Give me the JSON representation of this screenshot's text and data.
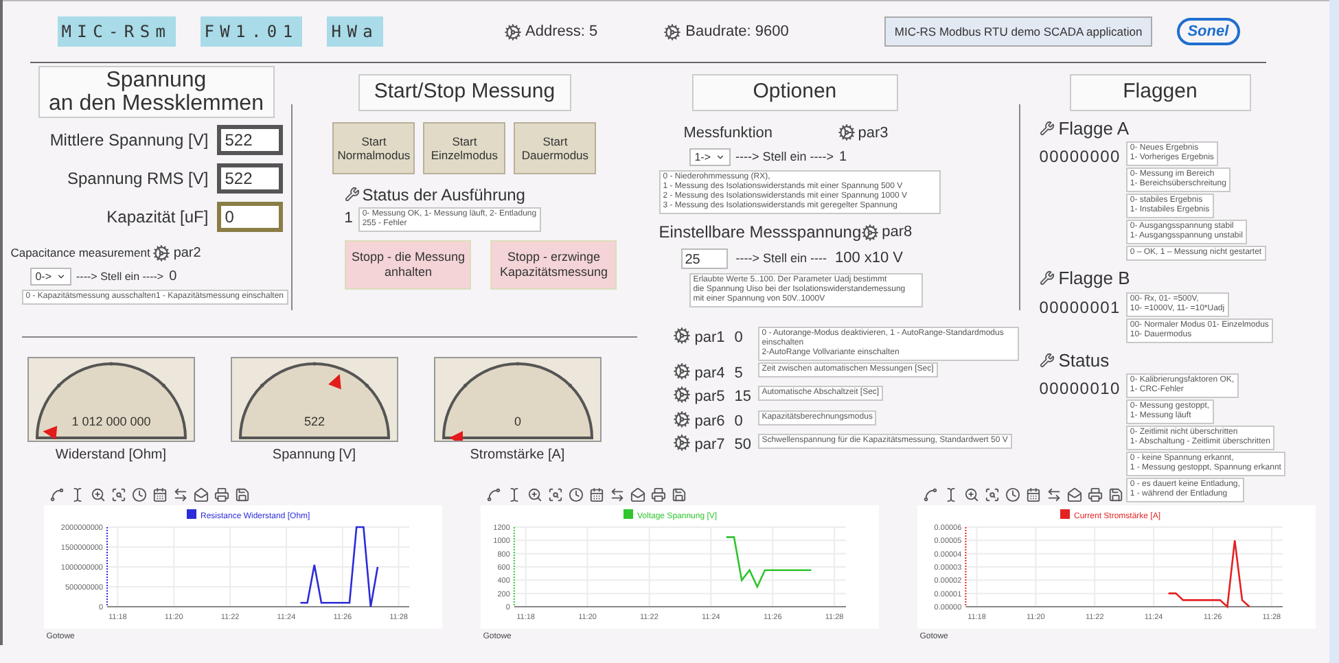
{
  "header": {
    "tags": [
      "MIC-RSm",
      "FW1.01",
      "HWa"
    ],
    "address": "Address: 5",
    "baudrate": "Baudrate: 9600",
    "app_title": "MIC-RS Modbus RTU demo SCADA application",
    "logo": "Sonel"
  },
  "voltage_panel": {
    "title_lines": [
      "Spannung",
      "an den Messklemmen"
    ],
    "fields": [
      {
        "label": "Mittlere Spannung [V]",
        "value": "522",
        "color": "#555555"
      },
      {
        "label": "Spannung RMS [V]",
        "value": "522",
        "color": "#555555"
      },
      {
        "label": "Kapazität [uF]",
        "value": "0",
        "color": "#8a7d45"
      }
    ],
    "capacitance": {
      "label": "Capacitance measurement",
      "param": "par2",
      "select": "0->",
      "arrow": "----> Stell ein ---->",
      "value": "0",
      "note": "0 - Kapazitätsmessung ausschalten1 - Kapazitätsmessung einschalten"
    }
  },
  "start_stop": {
    "title": "Start/Stop Messung",
    "start_buttons": [
      "Start Normalmodus",
      "Start Einzelmodus",
      "Start Dauermodus"
    ],
    "status_label": "Status der Ausführung",
    "status_value": "1",
    "status_note": "0- Messung OK, 1- Messung läuft, 2- Entladung\n255 - Fehler",
    "stop_buttons": [
      "Stopp - die Messung anhalten",
      "Stopp - erzwinge Kapazitätsmessung"
    ]
  },
  "options": {
    "title": "Optionen",
    "function": {
      "label": "Messfunktion",
      "param": "par3",
      "select": "1->",
      "arrow": "----> Stell ein ---->",
      "value": "1",
      "note": "0 - Niederohmmessung (RX),\n1 - Messung des Isolationswiderstands mit einer Spannung 500 V\n2 - Messung des Isolationswiderstands mit einer Spannung 1000 V\n3 - Messung des Isolationswiderstands mit geregelter Spannung"
    },
    "voltage": {
      "label": "Einstellbare Messspannung",
      "param": "par8",
      "input": "25",
      "arrow": "----> Stell ein ----",
      "value": "100 x10 V",
      "note": "Erlaubte Werte 5..100. Der Parameter Uadj bestimmt\ndie Spannung Uiso bei der Isolationswiderstandemessung\nmit einer Spannung von 50V..1000V"
    }
  },
  "params": [
    {
      "param": "par1",
      "value": "0",
      "note": "0 - Autorange-Modus deaktivieren, 1 - AutoRange-Standardmodus einschalten\n2-AutoRange Vollvariante einschalten"
    },
    {
      "param": "par4",
      "value": "5",
      "note": "Zeit zwischen automatischen Messungen [Sec]"
    },
    {
      "param": "par5",
      "value": "15",
      "note": "Automatische Abschaltzeit [Sec]"
    },
    {
      "param": "par6",
      "value": "0",
      "note": "Kapazitätsberechnungsmodus"
    },
    {
      "param": "par7",
      "value": "50",
      "note": "Schwellenspannung für die Kapazitätsmessung, Standardwert 50 V"
    }
  ],
  "flags": {
    "title": "Flaggen",
    "items": [
      {
        "label": "Flagge A",
        "value": "00000000",
        "notes": [
          "0- Neues Ergebnis\n1- Vorheriges Ergebnis",
          "0- Messung im Bereich\n1- Bereichsüberschreitung",
          "0- stabiles Ergebnis\n1- Instabiles Ergebnis",
          "0- Ausgangsspannung stabil\n1- Ausgangsspannung unstabil",
          "0 – OK,  1 – Messung nicht gestartet"
        ]
      },
      {
        "label": "Flagge B",
        "value": "00000001",
        "notes": [
          "00- Rx, 01- =500V,\n10- =1000V, 11- =10*Uadj",
          "00- Normaler Modus 01- Einzelmodus\n10- Dauermodus"
        ]
      },
      {
        "label": "Status",
        "value": "00000010",
        "notes": [
          "0- Kalibrierungsfaktoren OK,\n1- CRC-Fehler",
          "0- Messung gestoppt,\n1- Messung läuft",
          "0- Zeitlimit nicht überschritten\n1- Abschaltung - Zeitlimit überschritten",
          "0 - keine Spannung erkannt,\n1 - Messung gestoppt, Spannung erkannt",
          "0 - es dauert keine Entladung,\n1 - während der Entladung"
        ]
      }
    ]
  },
  "gauges": [
    {
      "label": "Widerstand [Ohm]",
      "reading": "1 012 000 000"
    },
    {
      "label": "Spannung [V]",
      "reading": "522"
    },
    {
      "label": "Stromstärke [A]",
      "reading": "0"
    }
  ],
  "charts": [
    {
      "status": "Gotowe",
      "chart_data": {
        "type": "line",
        "grid": true,
        "categories": [
          "11:18",
          null,
          null,
          null,
          null,
          null,
          null,
          null,
          "11:20",
          null,
          null,
          null,
          null,
          null,
          null,
          null,
          "11:22",
          null,
          null,
          null,
          null,
          null,
          null,
          null,
          "11:24",
          null,
          null,
          null,
          null,
          null,
          null,
          null,
          "11:26",
          null,
          null,
          null,
          null,
          null,
          null,
          null,
          "11:28"
        ],
        "series": [
          {
            "name": "Resistance Widerstand [Ohm]",
            "color": "#2b2bd9",
            "values": [
              null,
              null,
              null,
              null,
              null,
              null,
              null,
              null,
              null,
              null,
              null,
              null,
              null,
              null,
              null,
              null,
              null,
              null,
              null,
              null,
              null,
              null,
              null,
              null,
              null,
              null,
              100000000,
              100000000,
              1050000000,
              100000000,
              100000000,
              100000000,
              100000000,
              100000000,
              2000000000,
              2000000000,
              0,
              1000000000,
              null,
              null,
              null
            ]
          }
        ],
        "ylim": [
          0,
          2000000000
        ],
        "yticks": [
          0,
          500000000,
          1000000000,
          1500000000,
          2000000000
        ]
      }
    },
    {
      "status": "Gotowe",
      "chart_data": {
        "type": "line",
        "grid": true,
        "categories": [
          "11:18",
          null,
          null,
          null,
          null,
          null,
          null,
          null,
          "11:20",
          null,
          null,
          null,
          null,
          null,
          null,
          null,
          "11:22",
          null,
          null,
          null,
          null,
          null,
          null,
          null,
          "11:24",
          null,
          null,
          null,
          null,
          null,
          null,
          null,
          "11:26",
          null,
          null,
          null,
          null,
          null,
          null,
          null,
          "11:28"
        ],
        "series": [
          {
            "name": "Voltage Spannung [V]",
            "color": "#2ec52e",
            "values": [
              null,
              null,
              null,
              null,
              null,
              null,
              null,
              null,
              null,
              null,
              null,
              null,
              null,
              null,
              null,
              null,
              null,
              null,
              null,
              null,
              null,
              null,
              null,
              null,
              null,
              null,
              1050,
              1050,
              400,
              550,
              300,
              550,
              550,
              550,
              550,
              550,
              550,
              550,
              null,
              null,
              null
            ]
          }
        ],
        "ylim": [
          0,
          1200
        ],
        "yticks": [
          0,
          200,
          400,
          600,
          800,
          1000,
          1200
        ]
      }
    },
    {
      "status": "Gotowe",
      "chart_data": {
        "type": "line",
        "grid": true,
        "categories": [
          "11:18",
          null,
          null,
          null,
          null,
          null,
          null,
          null,
          "11:20",
          null,
          null,
          null,
          null,
          null,
          null,
          null,
          "11:22",
          null,
          null,
          null,
          null,
          null,
          null,
          null,
          "11:24",
          null,
          null,
          null,
          null,
          null,
          null,
          null,
          "11:26",
          null,
          null,
          null,
          null,
          null,
          null,
          null,
          "11:28"
        ],
        "series": [
          {
            "name": "Current Stromstärke [A]",
            "color": "#e52222",
            "values": [
              null,
              null,
              null,
              null,
              null,
              null,
              null,
              null,
              null,
              null,
              null,
              null,
              null,
              null,
              null,
              null,
              null,
              null,
              null,
              null,
              null,
              null,
              null,
              null,
              null,
              null,
              1e-05,
              1e-05,
              5e-06,
              5e-06,
              5e-06,
              5e-06,
              5e-06,
              5e-06,
              0,
              5e-05,
              5e-06,
              0,
              null,
              null,
              null
            ]
          }
        ],
        "ylim": [
          0,
          6e-05
        ],
        "yticks": [
          {
            "value": 0,
            "label": "0.00000"
          },
          {
            "value": 1e-05,
            "label": "0.00001"
          },
          {
            "value": 2e-05,
            "label": "0.00002"
          },
          {
            "value": 3e-05,
            "label": "0.00003"
          },
          {
            "value": 4e-05,
            "label": "0.00004"
          },
          {
            "value": 5e-05,
            "label": "0.00005"
          },
          {
            "value": 6e-05,
            "label": "0.00006"
          }
        ]
      }
    }
  ]
}
